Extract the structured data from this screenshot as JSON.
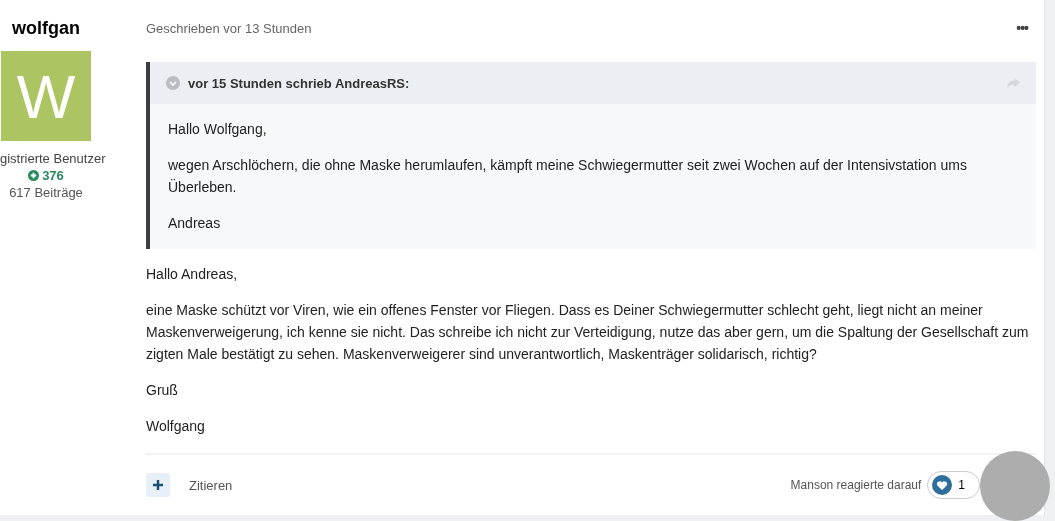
{
  "author": {
    "name": "wolfgan",
    "avatar_letter": "W",
    "group": "gistrierte Benutzer",
    "reputation": "376",
    "posts": "617 Beiträge"
  },
  "post": {
    "meta": "Geschrieben vor 13 Stunden",
    "menu": "•••",
    "quote": {
      "header": "vor 15 Stunden schrieb AndreasRS:",
      "expanded": true,
      "paragraphs": [
        "Hallo Wolfgang,",
        "wegen Arschlöchern, die ohne Maske herumlaufen, kämpft meine Schwiegermutter seit zwei Wochen auf der Intensivstation ums Überleben.",
        "Andreas"
      ]
    },
    "paragraphs": [
      "Hallo Andreas,",
      "eine Maske schützt vor Viren, wie ein offenes Fenster vor Fliegen. Dass es Deiner Schwiegermutter schlecht geht, liegt nicht an meiner Maskenverweigerung, ich kenne sie nicht. Das schreibe ich nicht zur Verteidigung, nutze das aber gern, um die Spaltung der Gesellschaft zum zigten Male bestätigt zu sehen. Maskenverweigerer sind unverantwortlich, Maskenträger solidarisch, richtig?",
      "Gruß",
      "Wolfgang"
    ],
    "quote_action": "Zitieren",
    "reaction_text": "Manson reagierte darauf",
    "reaction_count": "1"
  }
}
